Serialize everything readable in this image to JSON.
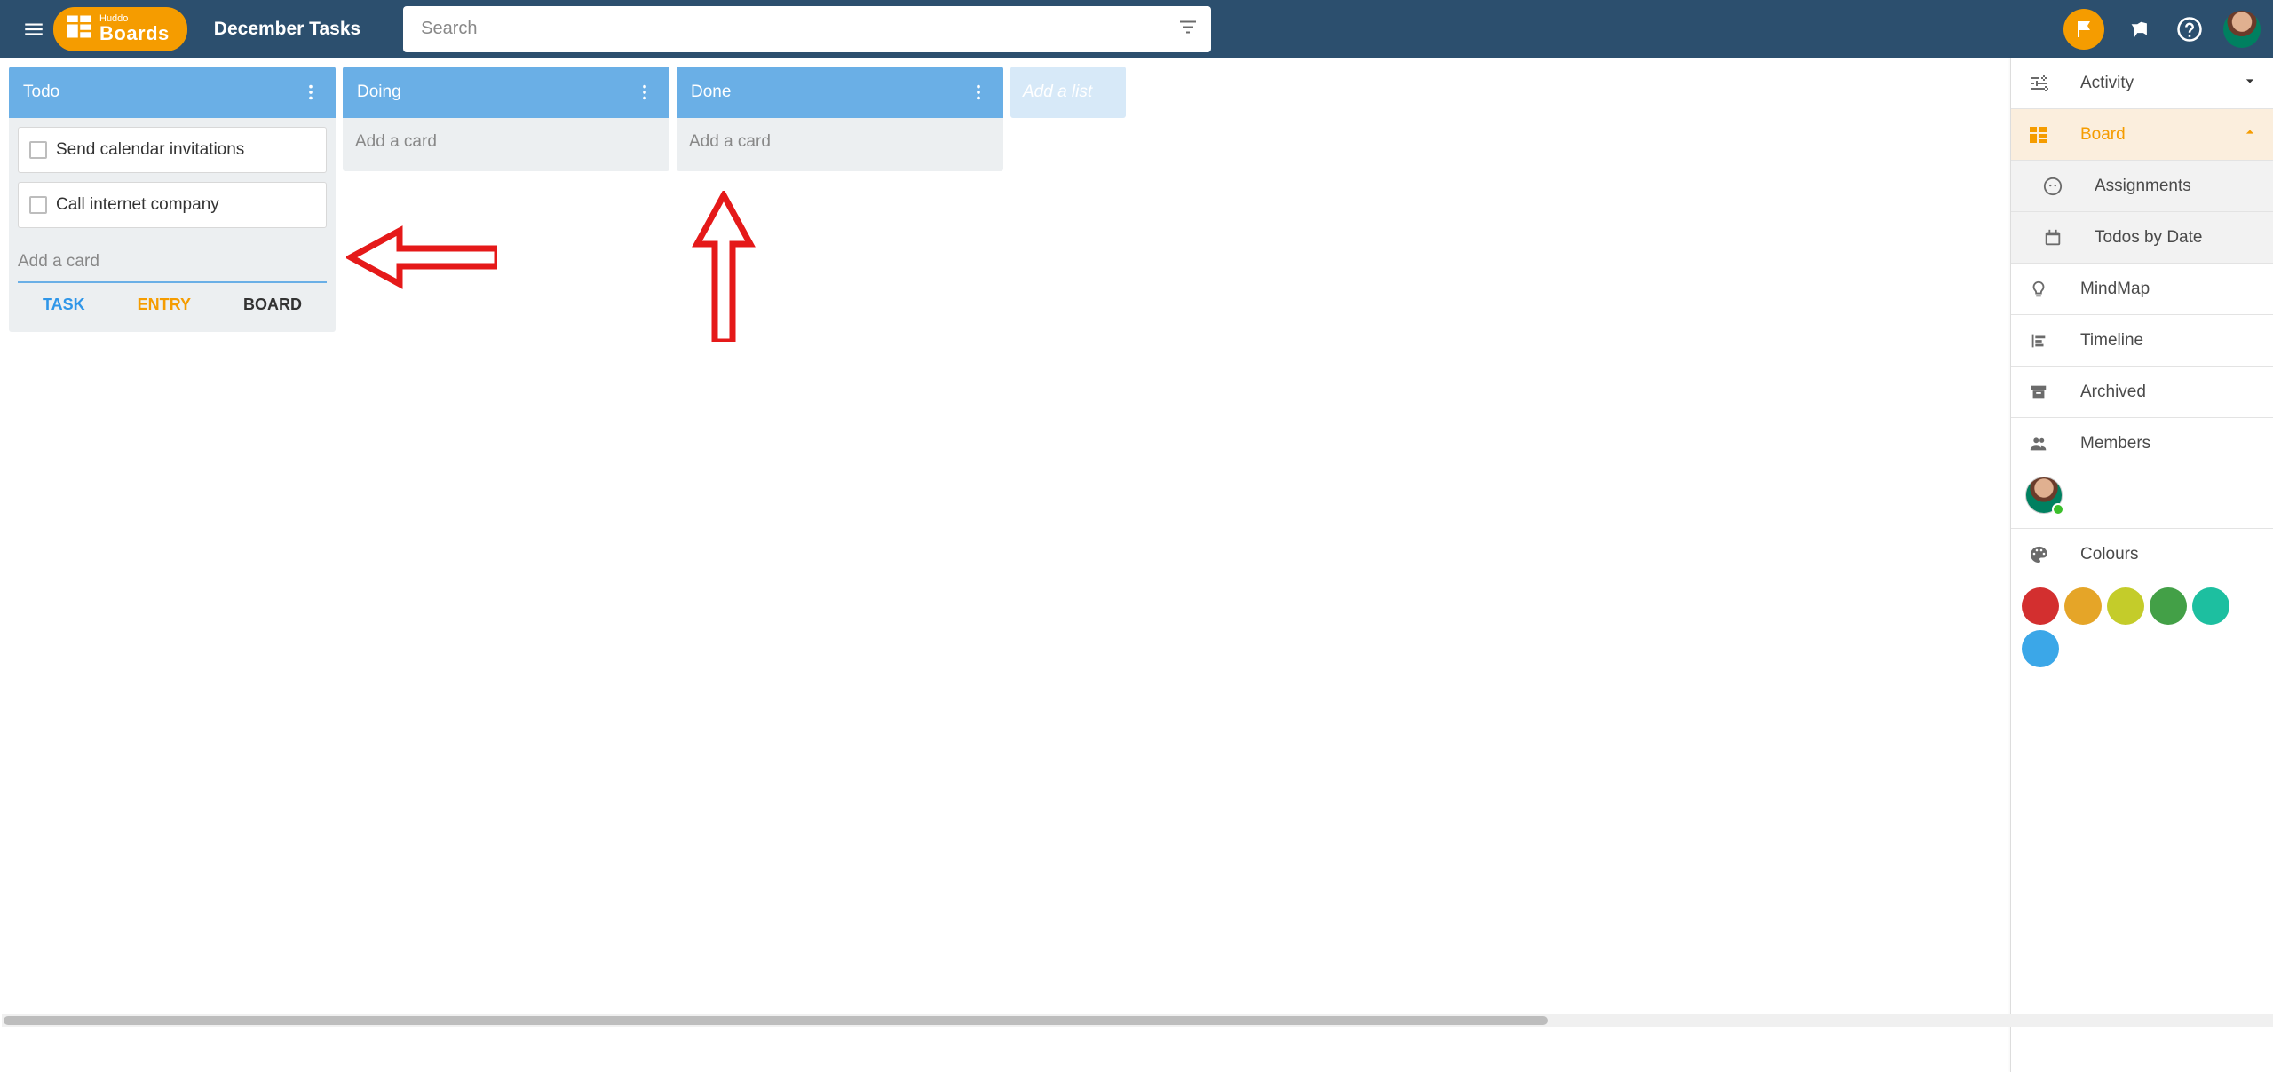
{
  "header": {
    "logo_small": "Huddo",
    "logo_big": "Boards",
    "board_title": "December Tasks",
    "search_placeholder": "Search"
  },
  "lists": [
    {
      "title": "Todo",
      "cards": [
        {
          "text": "Send calendar invitations"
        },
        {
          "text": "Call internet company"
        }
      ],
      "add_placeholder": "Add a card",
      "show_input": true
    },
    {
      "title": "Doing",
      "cards": [],
      "add_placeholder": "Add a card",
      "show_input": false
    },
    {
      "title": "Done",
      "cards": [],
      "add_placeholder": "Add a card",
      "show_input": false
    }
  ],
  "add_list_label": "Add a list",
  "card_type_tabs": {
    "task": "TASK",
    "entry": "ENTRY",
    "board": "BOARD"
  },
  "sidebar": {
    "activity": "Activity",
    "board": "Board",
    "assignments": "Assignments",
    "todos_by_date": "Todos by Date",
    "mindmap": "MindMap",
    "timeline": "Timeline",
    "archived": "Archived",
    "members": "Members",
    "colours": "Colours",
    "colour_values": [
      "#d32f2f",
      "#e5a528",
      "#c4cc2a",
      "#43a047",
      "#1dbfa0",
      "#3ba7e8",
      "#6a1b9a",
      "#283593"
    ]
  }
}
